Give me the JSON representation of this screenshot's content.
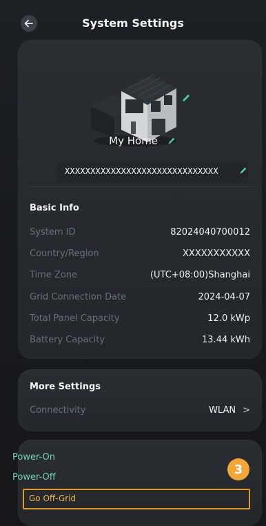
{
  "header": {
    "title": "System Settings"
  },
  "home": {
    "name": "My Home",
    "serial": "XXXXXXXXXXXXXXXXXXXXXXXXXXXXXX"
  },
  "basic_info": {
    "title": "Basic Info",
    "rows": [
      {
        "label": "System ID",
        "value": "82024040700012"
      },
      {
        "label": "Country/Region",
        "value": "XXXXXXXXXXX"
      },
      {
        "label": "Time Zone",
        "value": "(UTC+08:00)Shanghai"
      },
      {
        "label": "Grid Connection Date",
        "value": "2024-04-07"
      },
      {
        "label": "Total Panel Capacity",
        "value": "12.0 kWp"
      },
      {
        "label": "Battery Capacity",
        "value": "13.44 kWh"
      }
    ]
  },
  "more_settings": {
    "title": "More Settings",
    "connectivity_label": "Connectivity",
    "connectivity_value": "WLAN"
  },
  "power": {
    "on": "Power-On",
    "off": "Power-Off",
    "off_grid": "Go Off-Grid"
  },
  "annotation": {
    "step": "3"
  },
  "colors": {
    "accent_green": "#6fd1b2",
    "highlight_orange": "#e39a23",
    "background": "#17191c"
  }
}
